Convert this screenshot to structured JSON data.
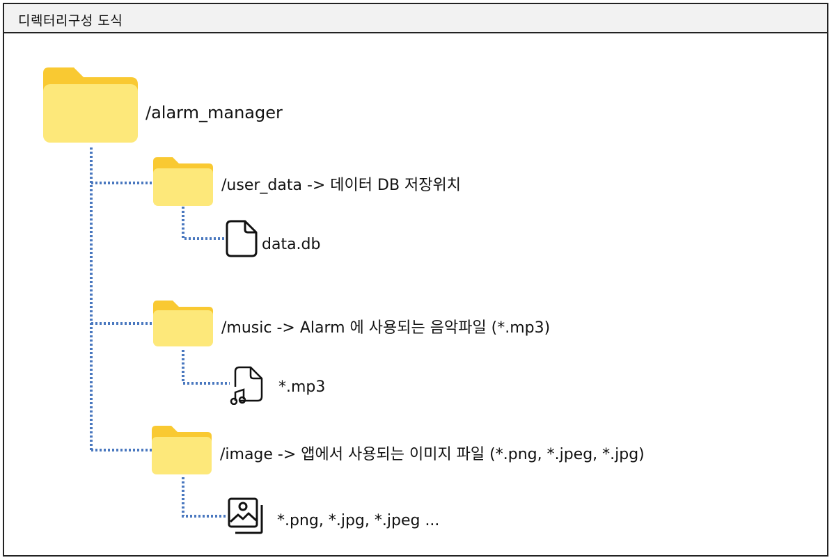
{
  "header": {
    "title": "디렉터리구성 도식"
  },
  "tree": {
    "root": {
      "name": "/alarm_manager",
      "icon": "folder-icon"
    },
    "folders": [
      {
        "name": "/user_data -> 데이터 DB 저장위치",
        "icon": "folder-icon",
        "file": {
          "name": "data.db",
          "icon": "file-icon"
        }
      },
      {
        "name": "/music -> Alarm 에 사용되는 음악파일 (*.mp3)",
        "icon": "folder-icon",
        "file": {
          "name": "*.mp3",
          "icon": "music-file-icon"
        }
      },
      {
        "name": "/image -> 앱에서 사용되는 이미지 파일 (*.png, *.jpeg, *.jpg)",
        "icon": "folder-icon",
        "file": {
          "name": "*.png, *.jpg, *.jpeg ...",
          "icon": "image-gallery-icon"
        }
      }
    ]
  },
  "colors": {
    "connector": "#4a78bf",
    "folder_back": "#f9c932",
    "folder_front": "#fde87a",
    "border": "#222222",
    "header_bg": "#f2f2f2"
  }
}
